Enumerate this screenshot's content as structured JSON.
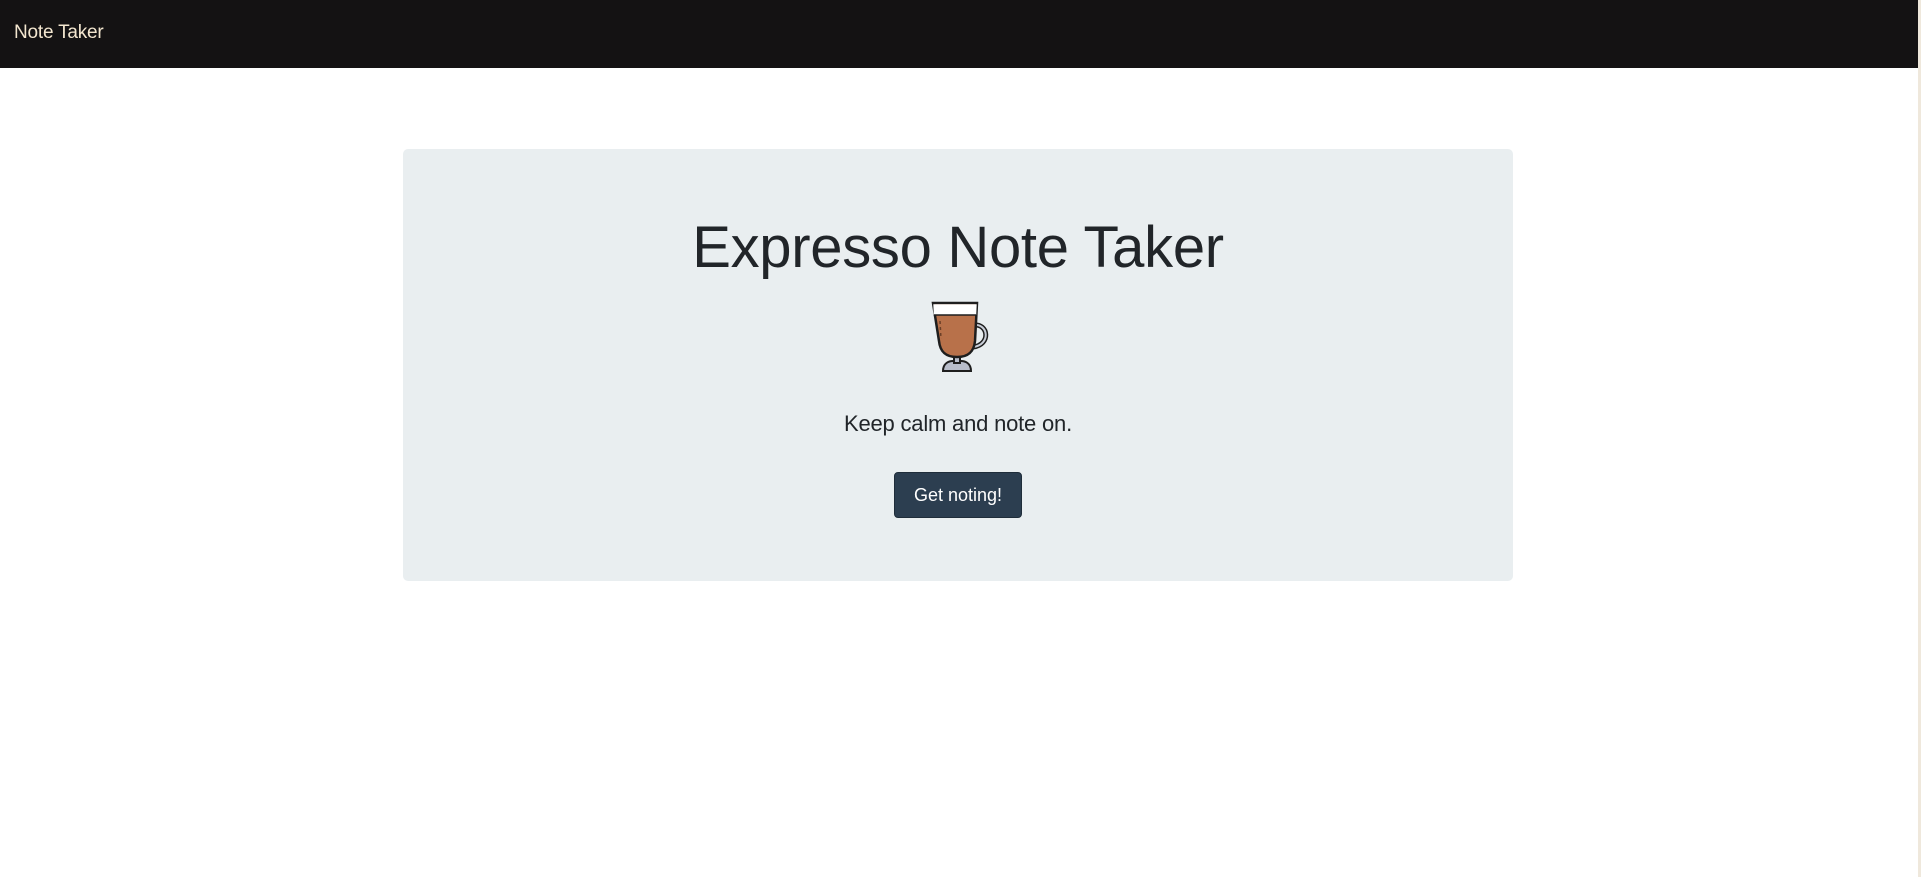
{
  "navbar": {
    "brand": "Note Taker"
  },
  "hero": {
    "title": "Expresso Note Taker",
    "icon": "coffee-cup-icon",
    "tagline": "Keep calm and note on.",
    "cta_label": "Get noting!"
  },
  "colors": {
    "navbar_bg": "#141213",
    "brand_text": "#f3e6cf",
    "hero_bg": "#e9eef0",
    "button_bg": "#2c3e50",
    "coffee": "#b8714a"
  }
}
